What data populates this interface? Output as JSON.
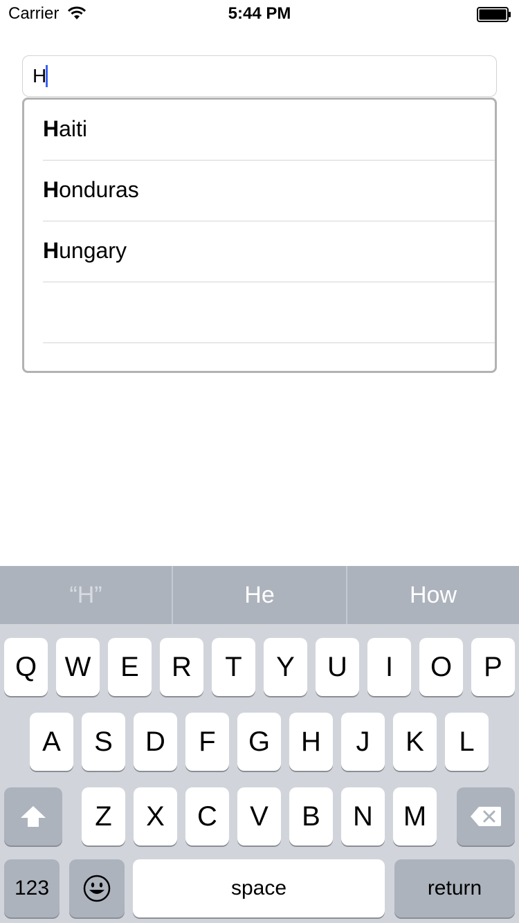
{
  "status_bar": {
    "carrier": "Carrier",
    "time": "5:44 PM",
    "wifi_icon": "wifi-icon",
    "battery_icon": "battery-full-icon"
  },
  "search": {
    "value": "H"
  },
  "suggestions": [
    {
      "match": "H",
      "rest": "aiti"
    },
    {
      "match": "H",
      "rest": "onduras"
    },
    {
      "match": "H",
      "rest": "ungary"
    },
    {
      "match": "",
      "rest": ""
    },
    {
      "match": "",
      "rest": ""
    }
  ],
  "keyboard": {
    "predictions": [
      "“H”",
      "He",
      "How"
    ],
    "row1": [
      "Q",
      "W",
      "E",
      "R",
      "T",
      "Y",
      "U",
      "I",
      "O",
      "P"
    ],
    "row2": [
      "A",
      "S",
      "D",
      "F",
      "G",
      "H",
      "J",
      "K",
      "L"
    ],
    "row3": [
      "Z",
      "X",
      "C",
      "V",
      "B",
      "N",
      "M"
    ],
    "shift_icon": "shift-icon",
    "delete_icon": "delete-icon",
    "numbers_label": "123",
    "emoji_icon": "emoji-icon",
    "space_label": "space",
    "return_label": "return",
    "colors": {
      "keyboard_bg": "#d1d5db",
      "predictive_bg": "#adb3bd",
      "dark_key": "#acb3bd",
      "caret": "#3a63f0"
    }
  }
}
